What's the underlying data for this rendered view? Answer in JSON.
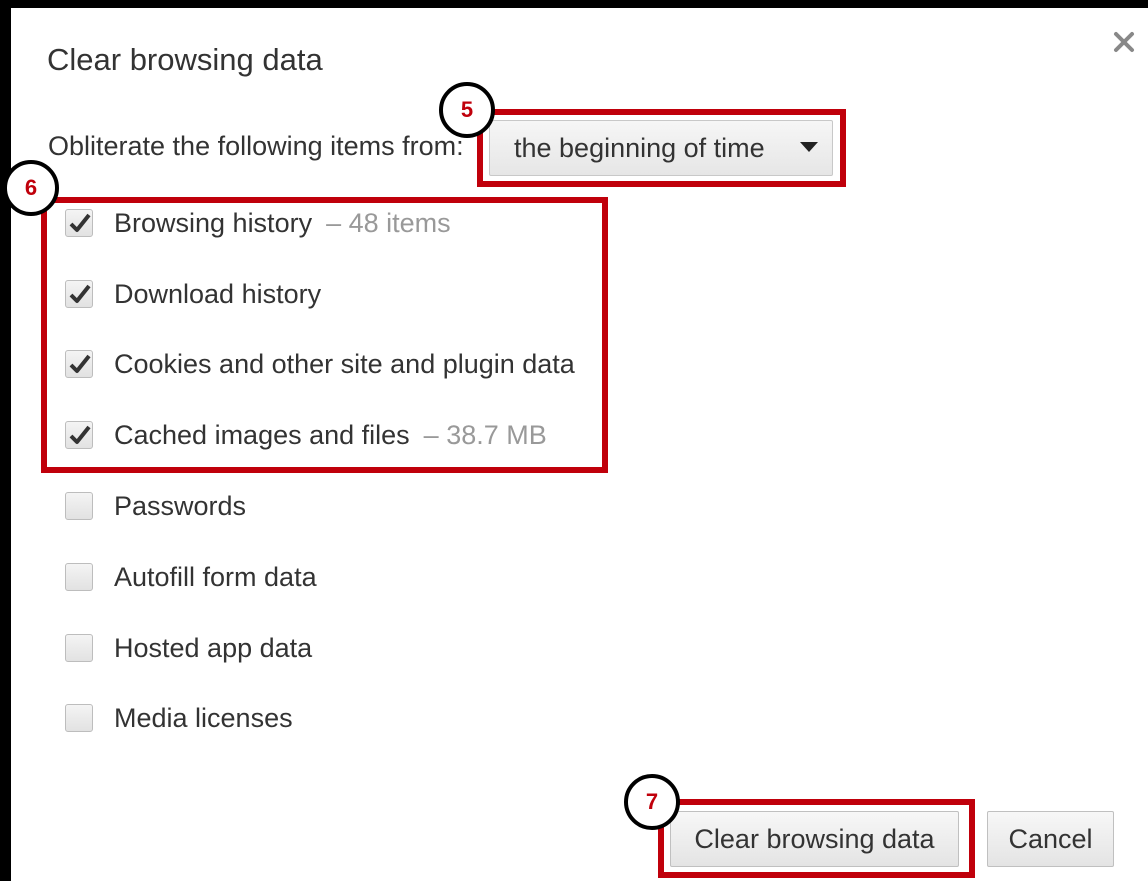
{
  "dialog": {
    "title": "Clear browsing data",
    "prompt": "Obliterate the following items from:",
    "time_range": "the beginning of time"
  },
  "options": [
    {
      "label": "Browsing history",
      "detail": "–  48 items",
      "checked": true
    },
    {
      "label": "Download history",
      "detail": "",
      "checked": true
    },
    {
      "label": "Cookies and other site and plugin data",
      "detail": "",
      "checked": true
    },
    {
      "label": "Cached images and files",
      "detail": "–  38.7 MB",
      "checked": true
    },
    {
      "label": "Passwords",
      "detail": "",
      "checked": false
    },
    {
      "label": "Autofill form data",
      "detail": "",
      "checked": false
    },
    {
      "label": "Hosted app data",
      "detail": "",
      "checked": false
    },
    {
      "label": "Media licenses",
      "detail": "",
      "checked": false
    }
  ],
  "buttons": {
    "clear": "Clear browsing data",
    "cancel": "Cancel"
  },
  "annotations": {
    "step_5": "5",
    "step_6": "6",
    "step_7": "7",
    "highlight_color": "#c0000b"
  },
  "icons": {
    "close": "close-icon",
    "caret": "chevron-down-icon",
    "check": "checkmark-icon"
  }
}
